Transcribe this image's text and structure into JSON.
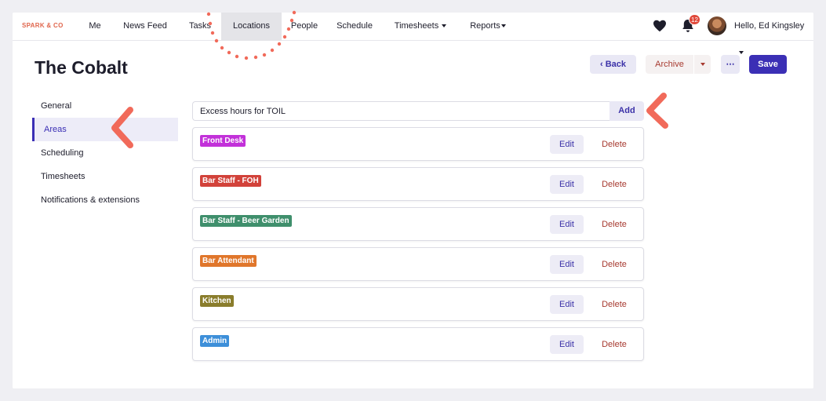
{
  "brand": "SPARK & CO",
  "nav": [
    {
      "label": "Me"
    },
    {
      "label": "News Feed"
    },
    {
      "label": "Tasks"
    },
    {
      "label": "Locations",
      "active": true
    },
    {
      "label": "People"
    },
    {
      "label": "Schedule"
    },
    {
      "label": "Timesheets",
      "dropdown": true
    },
    {
      "label": "Reports",
      "dropdown": true
    }
  ],
  "notifications": {
    "count": "12"
  },
  "user": {
    "greeting": "Hello, Ed Kingsley"
  },
  "page": {
    "title": "The Cobalt",
    "actions": {
      "back": "Back",
      "archive": "Archive",
      "more": "⋯",
      "save": "Save"
    }
  },
  "sidebar": {
    "items": [
      {
        "label": "General"
      },
      {
        "label": "Areas",
        "active": true
      },
      {
        "label": "Scheduling"
      },
      {
        "label": "Timesheets"
      },
      {
        "label": "Notifications & extensions"
      }
    ]
  },
  "add_area": {
    "value": "Excess hours for TOIL",
    "button": "Add"
  },
  "areas": [
    {
      "name": "Front Desk",
      "color": "#c231d9",
      "edit": "Edit",
      "delete": "Delete"
    },
    {
      "name": "Bar Staff - FOH",
      "color": "#d2423a",
      "edit": "Edit",
      "delete": "Delete"
    },
    {
      "name": "Bar Staff - Beer Garden",
      "color": "#3f8f6c",
      "edit": "Edit",
      "delete": "Delete"
    },
    {
      "name": "Bar Attendant",
      "color": "#e0762b",
      "edit": "Edit",
      "delete": "Delete"
    },
    {
      "name": "Kitchen",
      "color": "#8a7d2c",
      "edit": "Edit",
      "delete": "Delete"
    },
    {
      "name": "Admin",
      "color": "#3d8fd9",
      "edit": "Edit",
      "delete": "Delete"
    }
  ],
  "colors": {
    "accent": "#3b2fb5",
    "danger": "#a73a30",
    "annotation": "#f16a5a"
  }
}
